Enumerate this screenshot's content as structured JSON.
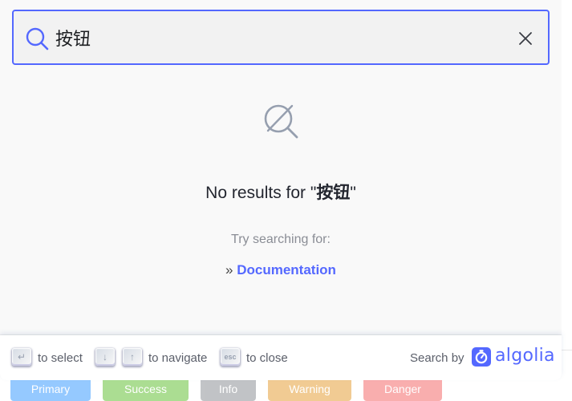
{
  "background": {
    "buttons": [
      {
        "label": "Primary",
        "color": "#409eff"
      },
      {
        "label": "Success",
        "color": "#67c23a"
      },
      {
        "label": "Info",
        "color": "#909399"
      },
      {
        "label": "Warning",
        "color": "#e6a23c"
      },
      {
        "label": "Danger",
        "color": "#f56c6c"
      }
    ]
  },
  "search": {
    "query": "按钮",
    "icon": "search-icon",
    "close_icon": "close-icon"
  },
  "no_results": {
    "icon": "search-off-icon",
    "prefix": "No results for \"",
    "query": "按钮",
    "suffix": "\"",
    "try_label": "Try searching for:",
    "suggestion_prefix": "» ",
    "suggestion": "Documentation"
  },
  "footer": {
    "select_key": "↵",
    "select_label": "to select",
    "down_key": "↓",
    "up_key": "↑",
    "navigate_label": "to navigate",
    "esc_key": "esc",
    "close_label": "to close",
    "search_by": "Search by",
    "brand": "algolia"
  },
  "colors": {
    "accent": "#5468ff",
    "modal_bg": "#f9f9f9",
    "input_bg": "#f2f2f2"
  }
}
